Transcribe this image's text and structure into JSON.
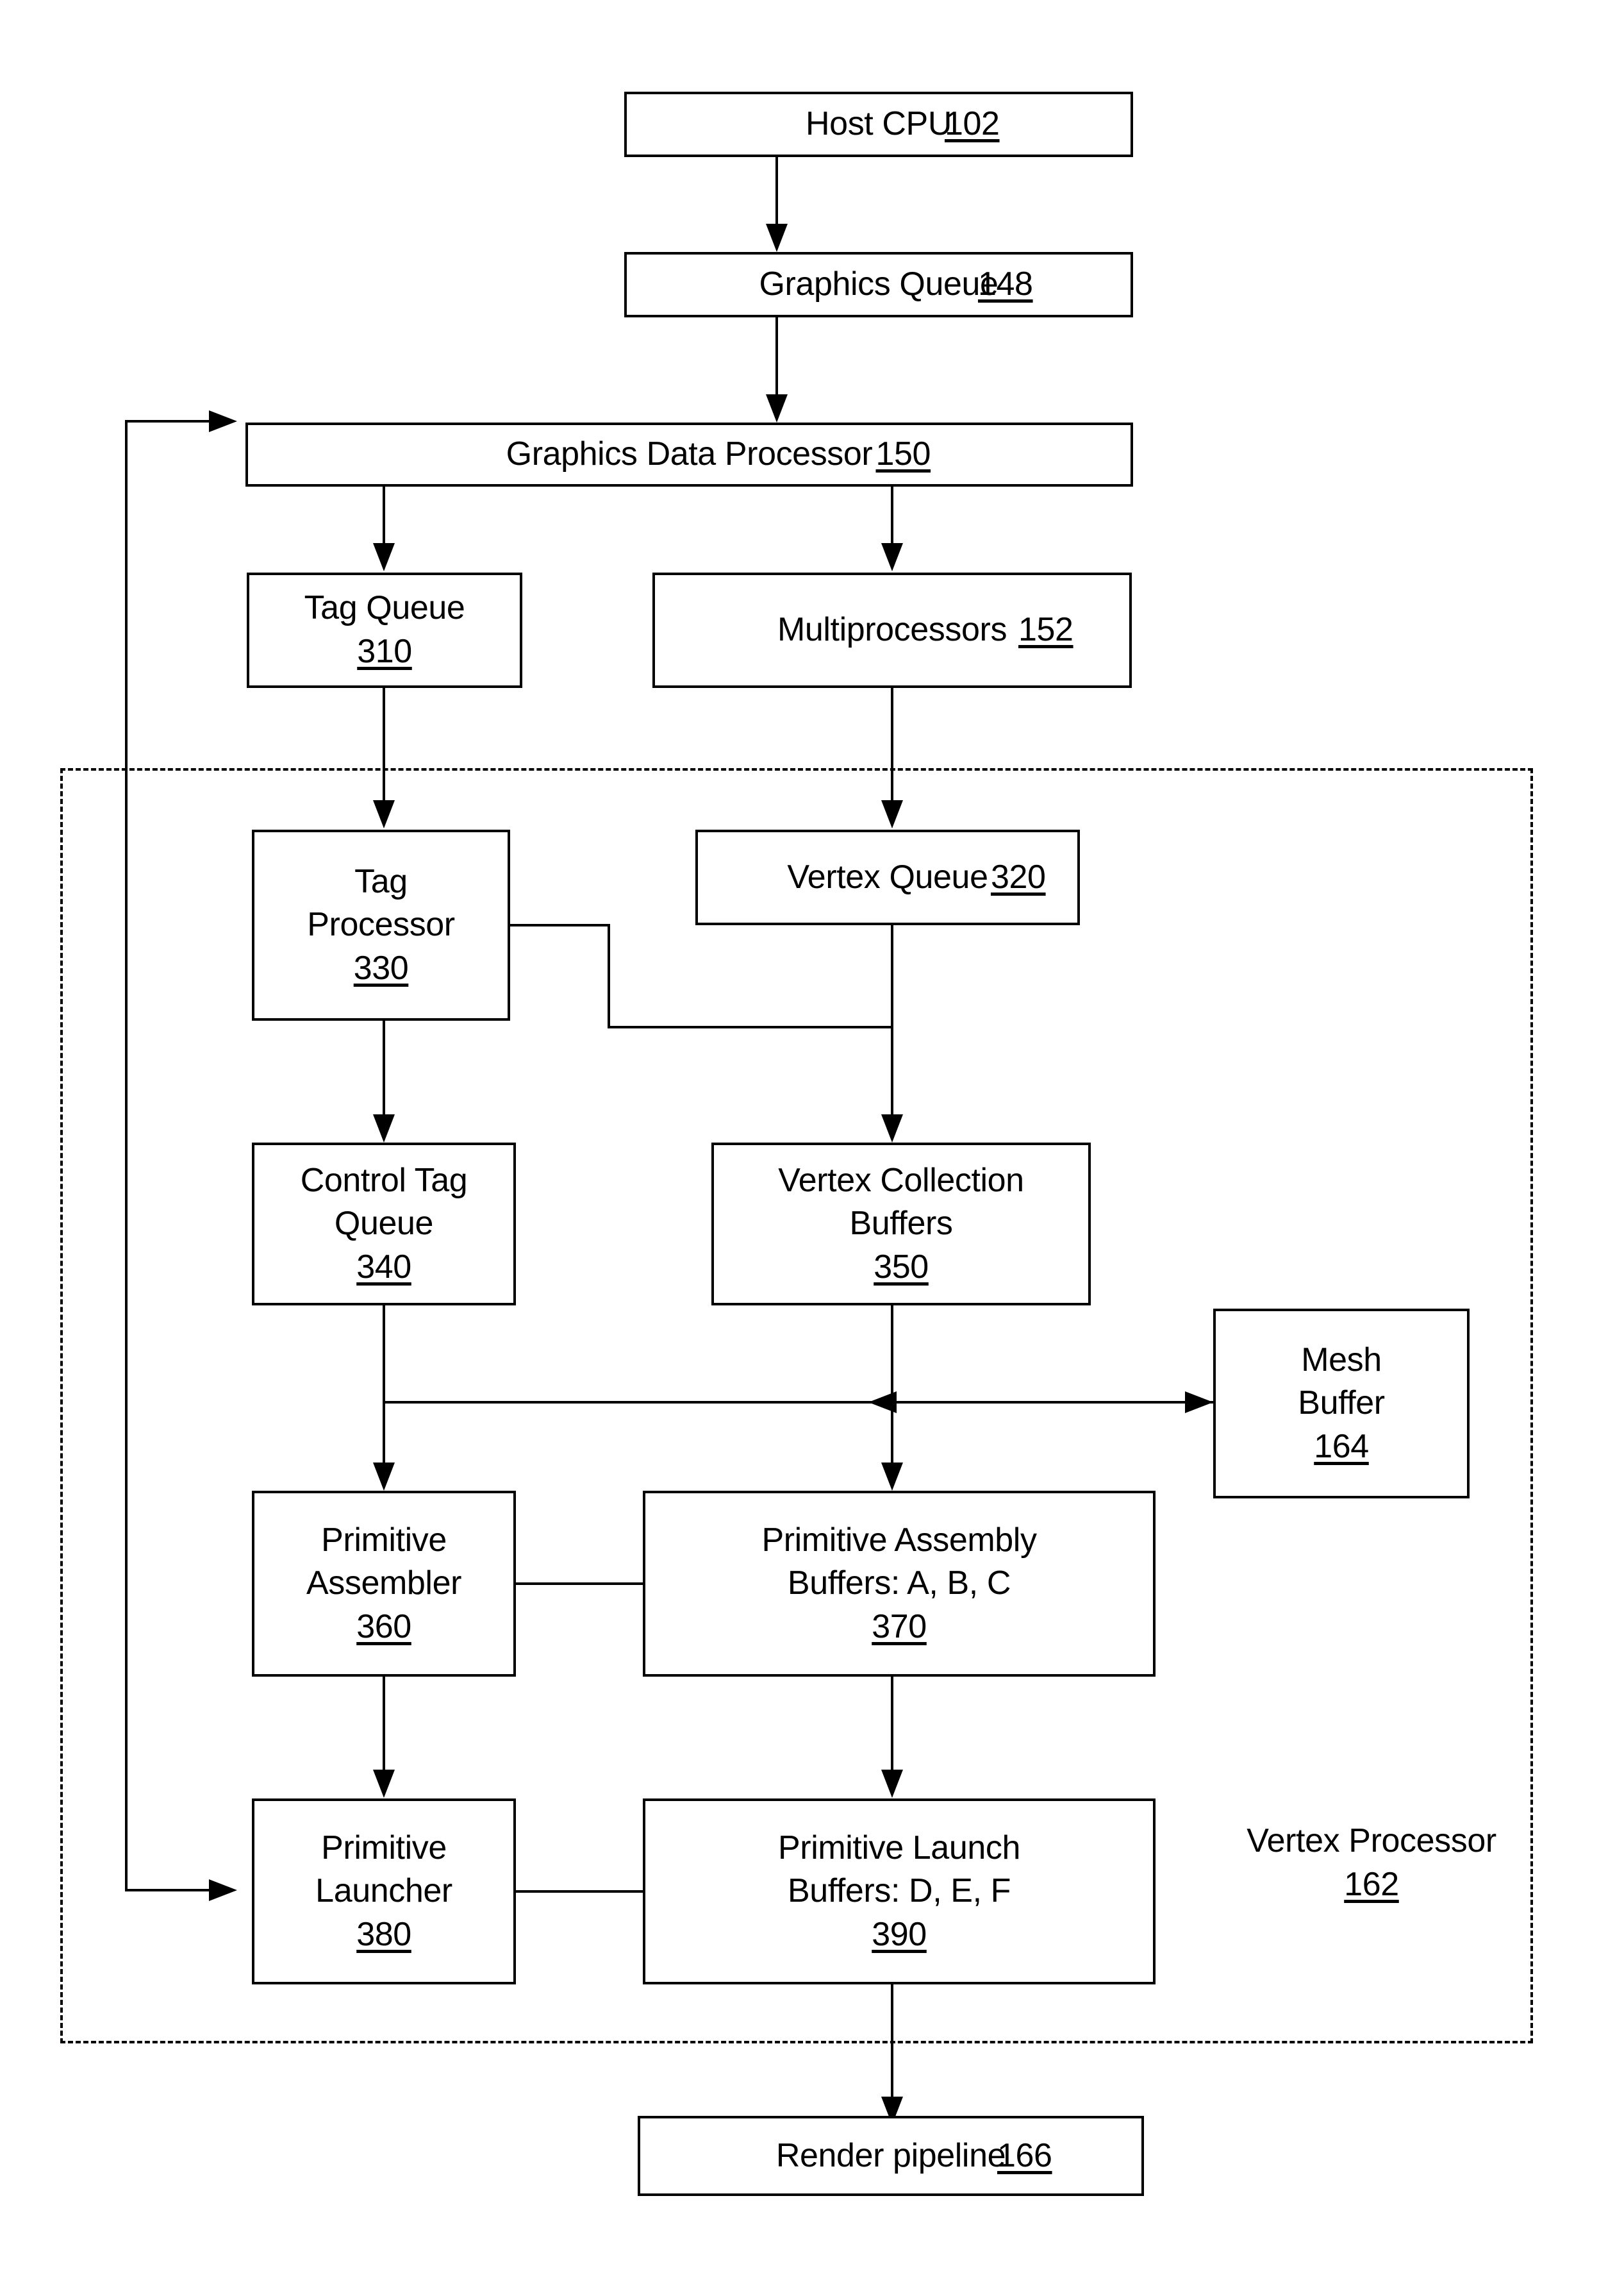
{
  "figure": {
    "type": "block-diagram",
    "description": "Graphics processing pipeline block diagram"
  },
  "blocks": {
    "host_cpu": {
      "lines": [
        "Host CPU"
      ],
      "ref": "102"
    },
    "graphics_queue": {
      "lines": [
        "Graphics Queue"
      ],
      "ref": "148"
    },
    "graphics_data_processor": {
      "lines": [
        "Graphics Data Processor"
      ],
      "ref": "150"
    },
    "tag_queue": {
      "lines": [
        "Tag Queue"
      ],
      "ref": "310"
    },
    "multiprocessors": {
      "lines": [
        "Multiprocessors"
      ],
      "ref": "152"
    },
    "tag_processor": {
      "lines": [
        "Tag",
        "Processor"
      ],
      "ref": "330"
    },
    "vertex_queue": {
      "lines": [
        "Vertex Queue"
      ],
      "ref": "320"
    },
    "control_tag_queue": {
      "lines": [
        "Control Tag",
        "Queue"
      ],
      "ref": "340"
    },
    "vertex_collection_buffers": {
      "lines": [
        "Vertex Collection",
        "Buffers"
      ],
      "ref": "350"
    },
    "mesh_buffer": {
      "lines": [
        "Mesh",
        "Buffer"
      ],
      "ref": "164"
    },
    "primitive_assembler": {
      "lines": [
        "Primitive",
        "Assembler"
      ],
      "ref": "360"
    },
    "primitive_assembly_buffers": {
      "lines": [
        "Primitive Assembly",
        "Buffers: A, B, C"
      ],
      "ref": "370"
    },
    "primitive_launcher": {
      "lines": [
        "Primitive",
        "Launcher"
      ],
      "ref": "380"
    },
    "primitive_launch_buffers": {
      "lines": [
        "Primitive Launch",
        "Buffers: D, E, F"
      ],
      "ref": "390"
    },
    "render_pipeline": {
      "lines": [
        "Render pipeline"
      ],
      "ref": "166"
    }
  },
  "labels": {
    "vertex_processor": {
      "lines": [
        "Vertex",
        "Processor"
      ],
      "ref": "162"
    }
  },
  "colors": {
    "stroke": "#000000",
    "background": "#ffffff"
  }
}
